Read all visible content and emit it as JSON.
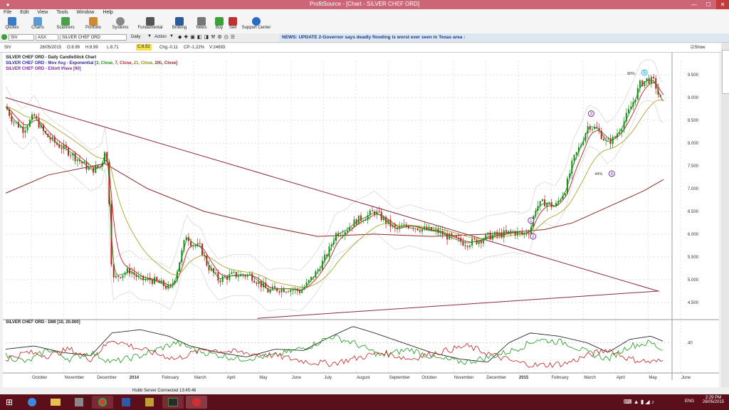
{
  "window": {
    "title": "ProfitSource - [Chart - SILVER CHEF ORD]"
  },
  "menu": [
    "File",
    "Edit",
    "View",
    "Tools",
    "Window",
    "Help"
  ],
  "toolbar": [
    "Quotes",
    "Charts",
    "Scanners",
    "Portfolio",
    "Systems",
    "Fundamental",
    "Broking",
    "News",
    "Buy",
    "Sell",
    "Support Center"
  ],
  "secbar": {
    "symbol": "SIV",
    "exchange": "ASX",
    "name": "SILVER CHEF ORD",
    "period": "Daily",
    "action": "Action"
  },
  "news": "NEWS: UPDATE 2-Governor says deadly flooding is worst ever seen in Texas area :",
  "quote": {
    "sym": "SIV",
    "date": "26/05/2015",
    "open": "O:8.99",
    "high": "H:8.99",
    "low": "L:8.71",
    "close": "C:8.92",
    "chg": "Chg:-0.11",
    "cp": "CP:-1.22%",
    "vol": "V:24693",
    "show_last": "Show Last"
  },
  "legends": {
    "line1": "SILVER CHEF ORD - Daily CandleStick Chart",
    "line2a": "SILVER CHEF ORD - Mov Avg - Exponential [",
    "line2b": "3, Close,",
    "line2c": " 7, Close,",
    "line2d": " 21, Close,",
    "line2e": " 200, Close]",
    "line3": "SILVER CHEF ORD - Elliott Wave [90]",
    "dmi": "SILVER CHEF ORD - DMI [10, 20.000]"
  },
  "chart_data": [
    {
      "type": "candlestick",
      "y_ticks": [
        "9.500",
        "9.000",
        "8.500",
        "8.000",
        "7.500",
        "7.000",
        "6.500",
        "6.000",
        "5.500",
        "5.000",
        "4.500"
      ],
      "x_ticks": [
        "October",
        "November",
        "December",
        "2014",
        "February",
        "March",
        "April",
        "May",
        "June",
        "July",
        "August",
        "September",
        "October",
        "November",
        "December",
        "2015",
        "February",
        "March",
        "April",
        "May",
        "June"
      ],
      "ylim": [
        4.2,
        9.8
      ],
      "close_path": [
        [
          0,
          8.8
        ],
        [
          10,
          8.5
        ],
        [
          25,
          8.3
        ],
        [
          40,
          8.6
        ],
        [
          55,
          8.2
        ],
        [
          70,
          8.0
        ],
        [
          90,
          7.8
        ],
        [
          105,
          7.6
        ],
        [
          120,
          7.4
        ],
        [
          135,
          7.5
        ],
        [
          140,
          7.9
        ],
        [
          145,
          7.3
        ],
        [
          148,
          5.6
        ],
        [
          152,
          5.0
        ],
        [
          160,
          5.1
        ],
        [
          175,
          5.2
        ],
        [
          190,
          5.0
        ],
        [
          205,
          5.0
        ],
        [
          220,
          4.9
        ],
        [
          232,
          4.8
        ],
        [
          240,
          5.1
        ],
        [
          250,
          5.7
        ],
        [
          255,
          6.0
        ],
        [
          262,
          5.8
        ],
        [
          275,
          5.7
        ],
        [
          285,
          5.3
        ],
        [
          300,
          5.0
        ],
        [
          320,
          5.1
        ],
        [
          345,
          5.1
        ],
        [
          360,
          4.9
        ],
        [
          370,
          4.75
        ],
        [
          385,
          4.8
        ],
        [
          400,
          4.8
        ],
        [
          415,
          4.75
        ],
        [
          425,
          4.9
        ],
        [
          440,
          5.2
        ],
        [
          455,
          5.6
        ],
        [
          465,
          6.0
        ],
        [
          480,
          6.1
        ],
        [
          495,
          6.3
        ],
        [
          510,
          6.4
        ],
        [
          520,
          6.5
        ],
        [
          535,
          6.3
        ],
        [
          550,
          6.1
        ],
        [
          570,
          6.2
        ],
        [
          590,
          6.1
        ],
        [
          610,
          6.05
        ],
        [
          630,
          5.9
        ],
        [
          650,
          5.8
        ],
        [
          665,
          5.85
        ],
        [
          680,
          5.95
        ],
        [
          700,
          6.0
        ],
        [
          715,
          6.05
        ],
        [
          730,
          6.0
        ],
        [
          740,
          6.1
        ],
        [
          748,
          6.6
        ],
        [
          760,
          6.7
        ],
        [
          775,
          6.6
        ],
        [
          790,
          7.0
        ],
        [
          800,
          7.6
        ],
        [
          812,
          8.0
        ],
        [
          822,
          8.4
        ],
        [
          835,
          8.3
        ],
        [
          848,
          8.0
        ],
        [
          858,
          8.1
        ],
        [
          870,
          8.4
        ],
        [
          885,
          8.9
        ],
        [
          895,
          9.3
        ],
        [
          905,
          9.4
        ],
        [
          915,
          9.35
        ],
        [
          922,
          9.0
        ],
        [
          925,
          8.9
        ]
      ],
      "ema200": [
        [
          0,
          6.9
        ],
        [
          60,
          7.3
        ],
        [
          140,
          7.55
        ],
        [
          200,
          7.0
        ],
        [
          280,
          6.5
        ],
        [
          360,
          6.2
        ],
        [
          440,
          5.95
        ],
        [
          520,
          6.0
        ],
        [
          600,
          5.95
        ],
        [
          680,
          6.0
        ],
        [
          760,
          6.1
        ],
        [
          800,
          6.25
        ],
        [
          850,
          6.6
        ],
        [
          900,
          6.95
        ],
        [
          928,
          7.2
        ]
      ],
      "trendlines": [
        [
          [
            0,
            9.0
          ],
          [
            920,
            4.75
          ]
        ],
        [
          [
            355,
            4.15
          ],
          [
            922,
            4.75
          ]
        ]
      ],
      "annotations": [
        {
          "x": 741,
          "y": 6.3,
          "label": "1"
        },
        {
          "x": 744,
          "y": 5.95,
          "label": "2"
        },
        {
          "x": 826,
          "y": 8.65,
          "label": "3"
        },
        {
          "x": 855,
          "y": 7.33,
          "label": "4"
        },
        {
          "x": 901,
          "y": 9.55,
          "label": "5"
        }
      ],
      "pct_labels": [
        {
          "x": 888,
          "y": 9.5,
          "label": "80%"
        },
        {
          "x": 842,
          "y": 7.3,
          "label": "44%"
        }
      ]
    },
    {
      "type": "line",
      "name": "DMI",
      "y_ticks": [
        "40"
      ],
      "ylim": [
        0,
        70
      ],
      "adx": [
        [
          0,
          30
        ],
        [
          40,
          35
        ],
        [
          80,
          25
        ],
        [
          120,
          20
        ],
        [
          150,
          55
        ],
        [
          190,
          60
        ],
        [
          230,
          50
        ],
        [
          260,
          35
        ],
        [
          300,
          25
        ],
        [
          340,
          18
        ],
        [
          380,
          30
        ],
        [
          420,
          28
        ],
        [
          460,
          50
        ],
        [
          490,
          65
        ],
        [
          520,
          55
        ],
        [
          560,
          40
        ],
        [
          600,
          25
        ],
        [
          640,
          15
        ],
        [
          680,
          10
        ],
        [
          710,
          40
        ],
        [
          740,
          55
        ],
        [
          780,
          50
        ],
        [
          820,
          40
        ],
        [
          850,
          25
        ],
        [
          880,
          45
        ],
        [
          910,
          50
        ],
        [
          928,
          42
        ]
      ],
      "pdi": [
        [
          0,
          20
        ],
        [
          30,
          10
        ],
        [
          60,
          30
        ],
        [
          90,
          15
        ],
        [
          120,
          25
        ],
        [
          150,
          10
        ],
        [
          190,
          20
        ],
        [
          240,
          40
        ],
        [
          280,
          25
        ],
        [
          330,
          15
        ],
        [
          380,
          20
        ],
        [
          430,
          35
        ],
        [
          460,
          50
        ],
        [
          490,
          40
        ],
        [
          530,
          20
        ],
        [
          570,
          30
        ],
        [
          610,
          15
        ],
        [
          650,
          10
        ],
        [
          690,
          20
        ],
        [
          720,
          30
        ],
        [
          750,
          45
        ],
        [
          790,
          40
        ],
        [
          820,
          25
        ],
        [
          850,
          15
        ],
        [
          880,
          35
        ],
        [
          910,
          40
        ],
        [
          928,
          28
        ]
      ],
      "mdi": [
        [
          0,
          15
        ],
        [
          30,
          25
        ],
        [
          60,
          20
        ],
        [
          90,
          30
        ],
        [
          120,
          15
        ],
        [
          150,
          45
        ],
        [
          190,
          30
        ],
        [
          240,
          15
        ],
        [
          280,
          30
        ],
        [
          330,
          25
        ],
        [
          380,
          20
        ],
        [
          430,
          10
        ],
        [
          460,
          8
        ],
        [
          490,
          15
        ],
        [
          530,
          25
        ],
        [
          570,
          15
        ],
        [
          610,
          25
        ],
        [
          650,
          35
        ],
        [
          690,
          20
        ],
        [
          720,
          10
        ],
        [
          750,
          5
        ],
        [
          790,
          8
        ],
        [
          820,
          20
        ],
        [
          850,
          30
        ],
        [
          880,
          15
        ],
        [
          910,
          10
        ],
        [
          928,
          12
        ]
      ]
    }
  ],
  "status": {
    "server": "Hubb Server Connected 13:45:46"
  },
  "tray": {
    "lang": "ENG",
    "time": "2:29 PM",
    "date": "26/05/2015"
  },
  "colors": {
    "titlebar": "#cc6677",
    "taskbar": "#5a0f1b",
    "ema3": "#1a8f1a",
    "ema7": "#c02020",
    "ema21": "#a8a830",
    "ema200": "#8b2a2a",
    "wave": "#7a2a9a"
  }
}
